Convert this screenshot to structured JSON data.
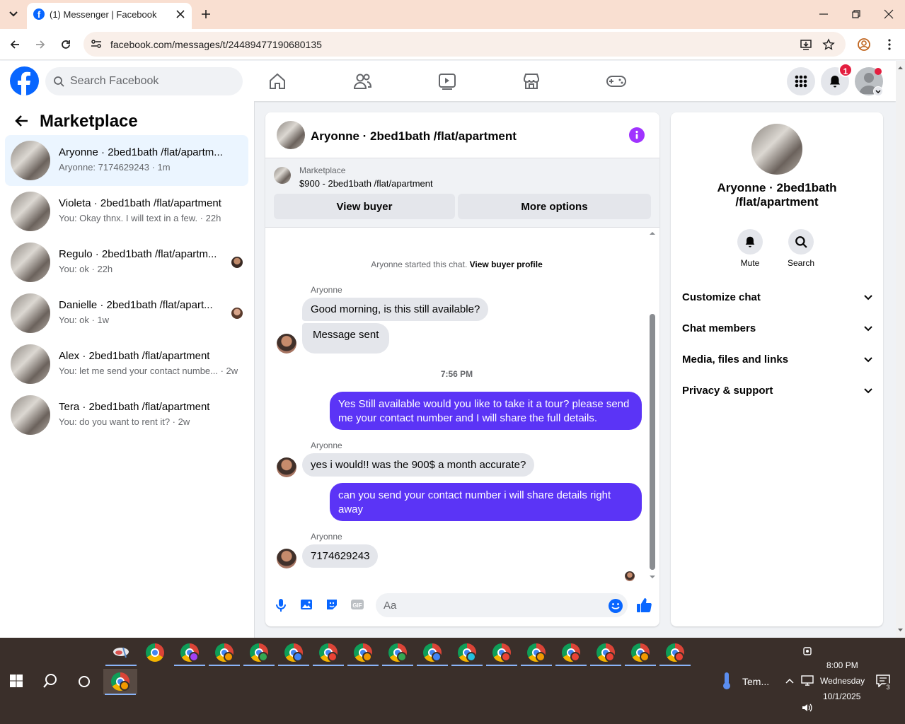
{
  "browser": {
    "tab_title": "(1) Messenger | Facebook",
    "url": "facebook.com/messages/t/24489477190680135"
  },
  "header": {
    "search_placeholder": "Search Facebook",
    "notification_count": "1"
  },
  "sidebar": {
    "title": "Marketplace",
    "conversations": [
      {
        "name": "Aryonne · 2bed1bath /flat/apartm...",
        "preview": "Aryonne: 7174629243 · 1m",
        "selected": true
      },
      {
        "name": "Violeta · 2bed1bath /flat/apartment",
        "preview": "You: Okay thnx. I will text in a few. · 22h"
      },
      {
        "name": "Regulo · 2bed1bath /flat/apartm...",
        "preview": "You: ok · 22h"
      },
      {
        "name": "Danielle · 2bed1bath /flat/apart...",
        "preview": "You: ok · 1w"
      },
      {
        "name": "Alex · 2bed1bath /flat/apartment",
        "preview": "You: let me send your contact numbe... · 2w"
      },
      {
        "name": "Tera · 2bed1bath /flat/apartment",
        "preview": "You: do you want to rent it? · 2w"
      }
    ]
  },
  "chat": {
    "title": "Aryonne · 2bed1bath /flat/apartment",
    "listing_label": "Marketplace",
    "listing_title": "$900 - 2bed1bath /flat/apartment",
    "view_buyer": "View buyer",
    "more_options": "More options",
    "started_text": "Aryonne started this chat.",
    "view_buyer_profile": "View buyer profile",
    "messages": [
      {
        "sender": "Aryonne",
        "text": "Good morning, is this still available?"
      },
      {
        "text": "Message sent"
      },
      {
        "time": "7:56 PM"
      },
      {
        "out": "Yes Still available would you like to take it a tour? please send me your contact number and I will share the full details."
      },
      {
        "sender": "Aryonne",
        "text": "yes i would!! was the 900$ a month accurate?"
      },
      {
        "out": "can you send your contact number i will share details right away"
      },
      {
        "sender": "Aryonne",
        "text": "7174629243"
      }
    ],
    "input_placeholder": "Aa"
  },
  "right_panel": {
    "name": "Aryonne · 2bed1bath /flat/apartment",
    "mute": "Mute",
    "search": "Search",
    "sections": [
      "Customize chat",
      "Chat members",
      "Media, files and links",
      "Privacy & support"
    ]
  },
  "taskbar": {
    "weather": "Tem...",
    "time": "8:00 PM",
    "day": "Wednesday",
    "date": "10/1/2025",
    "notification_count": "3"
  },
  "colors": {
    "accent": "#5b34f6",
    "facebook_blue": "#0866ff",
    "info_purple": "#a033ff",
    "badge_red": "#e41e3f"
  }
}
